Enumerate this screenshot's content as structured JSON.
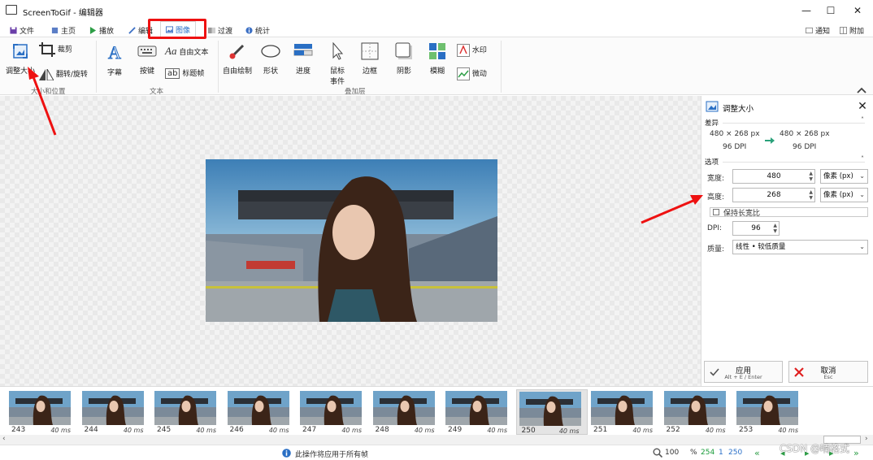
{
  "window": {
    "title": "ScreenToGif - 编辑器",
    "minimize": "—",
    "maximize": "☐",
    "close": "✕"
  },
  "tabs": [
    {
      "label": "文件",
      "icon": "save-icon"
    },
    {
      "label": "主页",
      "icon": "home-icon"
    },
    {
      "label": "播放",
      "icon": "play-icon"
    },
    {
      "label": "编辑",
      "icon": "pencil-icon"
    },
    {
      "label": "图像",
      "icon": "image-icon",
      "active": true
    },
    {
      "label": "过渡",
      "icon": "transition-icon"
    },
    {
      "label": "统计",
      "icon": "info-icon"
    }
  ],
  "right_tabs": {
    "notify": "通知",
    "attach": "附加"
  },
  "ribbon": {
    "size_group": {
      "label": "大小和位置",
      "resize": "调整大小",
      "crop": "裁剪",
      "flip": "翻转/旋转"
    },
    "text_group": {
      "label": "文本",
      "caption": "字幕",
      "keystrokes": "按键",
      "free_text": "自由文本",
      "title_frame": "标题帧",
      "aa_glyph": "Aa",
      "ab_glyph": "ab"
    },
    "overlay_group": {
      "label": "叠加层",
      "free_drawing": "自由绘制",
      "shape": "形状",
      "progress": "进度",
      "mouse_events": "鼠标事件",
      "border": "边框",
      "shadow": "阴影",
      "blur": "模糊",
      "watermark": "水印",
      "cinemagraph": "微动"
    }
  },
  "panel": {
    "title": "调整大小",
    "diff_section": "差异",
    "from_size": "480 × 268 px",
    "from_dpi": "96 DPI",
    "to_size": "480 × 268 px",
    "to_dpi": "96 DPI",
    "options_section": "选项",
    "width_label": "宽度:",
    "width_value": "480",
    "width_unit": "像素 (px)",
    "height_label": "高度:",
    "height_value": "268",
    "height_unit": "像素 (px)",
    "keep_ratio": "保持长宽比",
    "keep_ratio_checked": false,
    "dpi_label": "DPI:",
    "dpi_value": "96",
    "quality_label": "质量:",
    "quality_value": "线性 • 较低质量",
    "apply_label": "应用",
    "apply_shortcut": "Alt + E / Enter",
    "cancel_label": "取消",
    "cancel_shortcut": "Esc"
  },
  "frames": [
    {
      "number": "243",
      "delay": "40 ms"
    },
    {
      "number": "244",
      "delay": "40 ms"
    },
    {
      "number": "245",
      "delay": "40 ms"
    },
    {
      "number": "246",
      "delay": "40 ms"
    },
    {
      "number": "247",
      "delay": "40 ms"
    },
    {
      "number": "248",
      "delay": "40 ms"
    },
    {
      "number": "249",
      "delay": "40 ms"
    },
    {
      "number": "250",
      "delay": "40 ms",
      "selected": true
    },
    {
      "number": "251",
      "delay": "40 ms"
    },
    {
      "number": "252",
      "delay": "40 ms"
    },
    {
      "number": "253",
      "delay": "40 ms"
    }
  ],
  "status": {
    "message": "此操作将应用于所有帧",
    "zoom": "100",
    "zoom_unit": "%",
    "selected_frame": "254",
    "selected_count": "1",
    "total_frames": "250"
  },
  "watermark": "CSDN @喃格式",
  "colors": {
    "highlight_red": "#e11111",
    "accent_blue": "#2a70c8",
    "status_green": "#1a9c3a",
    "arrow_green": "#2aa17a"
  }
}
